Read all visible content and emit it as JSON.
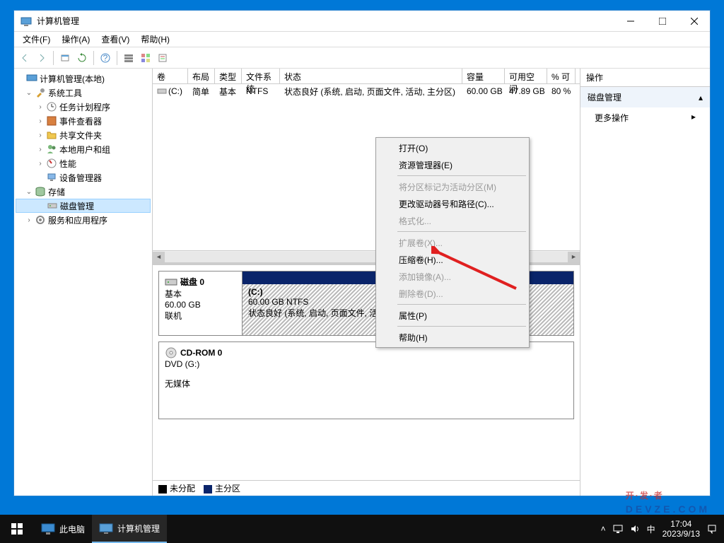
{
  "window": {
    "title": "计算机管理",
    "menus": {
      "file": "文件(F)",
      "action": "操作(A)",
      "view": "查看(V)",
      "help": "帮助(H)"
    }
  },
  "tree": {
    "root": "计算机管理(本地)",
    "system_tools": "系统工具",
    "task_scheduler": "任务计划程序",
    "event_viewer": "事件查看器",
    "shared_folders": "共享文件夹",
    "local_users": "本地用户和组",
    "performance": "性能",
    "device_manager": "设备管理器",
    "storage": "存储",
    "disk_mgmt": "磁盘管理",
    "services": "服务和应用程序"
  },
  "vol_headers": {
    "vol": "卷",
    "layout": "布局",
    "type": "类型",
    "fs": "文件系统",
    "status": "状态",
    "cap": "容量",
    "free": "可用空间",
    "pct": "% 可"
  },
  "vol_row": {
    "vol": "(C:)",
    "layout": "简单",
    "type": "基本",
    "fs": "NTFS",
    "status": "状态良好 (系统, 启动, 页面文件, 活动, 主分区)",
    "cap": "60.00 GB",
    "free": "47.89 GB",
    "pct": "80 %"
  },
  "disk0": {
    "name": "磁盘 0",
    "type": "基本",
    "size": "60.00 GB",
    "state": "联机",
    "part": {
      "name": "(C:)",
      "desc": "60.00 GB NTFS",
      "status": "状态良好 (系统, 启动, 页面文件, 活动, 主分区)"
    }
  },
  "cdrom": {
    "name": "CD-ROM 0",
    "type": "DVD (G:)",
    "state": "无媒体"
  },
  "legend": {
    "unalloc": "未分配",
    "primary": "主分区"
  },
  "actions": {
    "header": "操作",
    "group": "磁盘管理",
    "more": "更多操作"
  },
  "context": {
    "open": "打开(O)",
    "explorer": "资源管理器(E)",
    "mark_active": "将分区标记为活动分区(M)",
    "change_drive": "更改驱动器号和路径(C)...",
    "format": "格式化...",
    "extend": "扩展卷(X)...",
    "shrink": "压缩卷(H)...",
    "add_mirror": "添加镜像(A)...",
    "delete": "删除卷(D)...",
    "properties": "属性(P)",
    "help": "帮助(H)"
  },
  "taskbar": {
    "this_pc": "此电脑",
    "app": "计算机管理",
    "lang": "中",
    "time": "17:04",
    "date": "2023/9/13"
  },
  "watermark": {
    "top": "开·发·者",
    "sub": "DEVZE.COM"
  }
}
